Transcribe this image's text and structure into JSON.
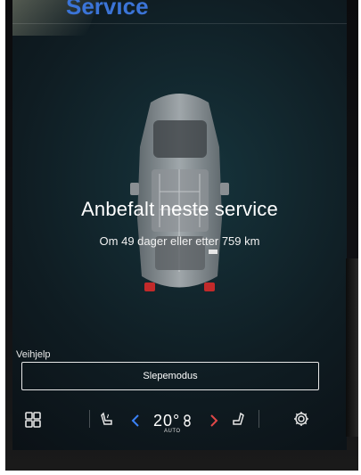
{
  "header": {
    "title": "Service"
  },
  "service": {
    "title": "Anbefalt neste service",
    "subtitle": "Om 49 dager eller etter 759 km"
  },
  "roadside": {
    "label": "Veihjelp",
    "tow_button": "Slepemodus"
  },
  "climate": {
    "temperature": "20°",
    "mode": "AUTO"
  },
  "icons": {
    "home": "grid-icon",
    "seat_left": "seat-heat-icon",
    "temp_down": "chevron-left-icon",
    "temp_up": "chevron-right-icon",
    "seat_right": "seat-icon",
    "settings": "gear-icon"
  },
  "colors": {
    "accent_blue": "#3b74d7",
    "chevron_left": "#3b82f6",
    "chevron_right": "#e04848"
  }
}
